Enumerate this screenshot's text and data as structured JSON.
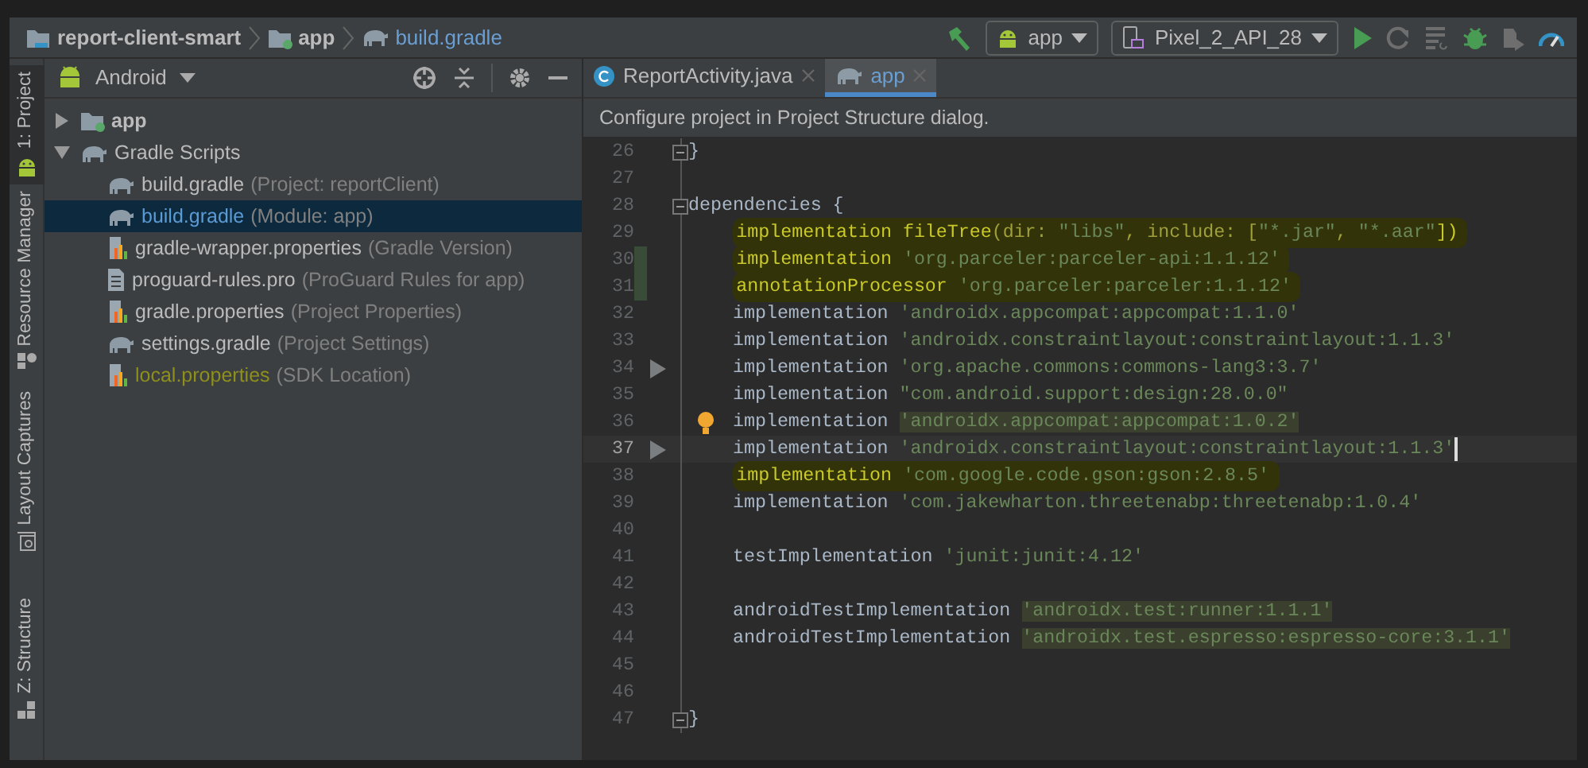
{
  "breadcrumbs": [
    {
      "label": "report-client-smart",
      "kind": "project",
      "current": false
    },
    {
      "label": "app",
      "kind": "module",
      "current": false
    },
    {
      "label": "build.gradle",
      "kind": "gradle",
      "current": true
    }
  ],
  "toolbar": {
    "run_configuration": "app",
    "device": "Pixel_2_API_28"
  },
  "tool_stripe": [
    {
      "label": "1: Project",
      "selected": true
    },
    {
      "label": "Resource Manager",
      "selected": false
    },
    {
      "label": "Layout Captures",
      "selected": false
    },
    {
      "label": "Z: Structure",
      "selected": false
    }
  ],
  "project_panel": {
    "view": "Android",
    "tree": [
      {
        "label": "app",
        "kind": "module",
        "expanded": false,
        "selected": false,
        "ignored": false
      },
      {
        "label": "Gradle Scripts",
        "kind": "gradle",
        "expanded": true,
        "selected": false,
        "ignored": false,
        "children": [
          {
            "label": "build.gradle",
            "detail": "(Project: reportClient)",
            "kind": "gradle",
            "selected": false,
            "ignored": false
          },
          {
            "label": "build.gradle",
            "detail": "(Module: app)",
            "kind": "gradle",
            "selected": true,
            "ignored": false
          },
          {
            "label": "gradle-wrapper.properties",
            "detail": "(Gradle Version)",
            "kind": "properties",
            "selected": false,
            "ignored": false
          },
          {
            "label": "proguard-rules.pro",
            "detail": "(ProGuard Rules for app)",
            "kind": "text",
            "selected": false,
            "ignored": false
          },
          {
            "label": "gradle.properties",
            "detail": "(Project Properties)",
            "kind": "properties",
            "selected": false,
            "ignored": false
          },
          {
            "label": "settings.gradle",
            "detail": "(Project Settings)",
            "kind": "gradle",
            "selected": false,
            "ignored": false
          },
          {
            "label": "local.properties",
            "detail": "(SDK Location)",
            "kind": "properties",
            "selected": false,
            "ignored": true
          }
        ]
      }
    ]
  },
  "editor": {
    "tabs": [
      {
        "label": "ReportActivity.java",
        "kind": "java",
        "selected": false
      },
      {
        "label": "app",
        "kind": "gradle",
        "selected": true
      }
    ],
    "notification": "Configure project in Project Structure dialog.",
    "lines": [
      {
        "number": "26",
        "kind": "fold",
        "segments": [
          {
            "text": "}",
            "kind": "code"
          }
        ]
      },
      {
        "number": "27",
        "kind": "plain"
      },
      {
        "number": "28",
        "kind": "fold",
        "segments": [
          {
            "text": "dependencies {",
            "kind": "code"
          }
        ]
      },
      {
        "number": "29",
        "kind": "plain",
        "marked": true,
        "segments": [
          {
            "text": "implementation fileTree",
            "kind": "code"
          },
          {
            "text": "(dir: ",
            "kind": "param"
          },
          {
            "text": "\"libs\"",
            "kind": "string"
          },
          {
            "text": ", include: [",
            "kind": "param"
          },
          {
            "text": "\"*.jar\"",
            "kind": "string"
          },
          {
            "text": ", ",
            "kind": "param"
          },
          {
            "text": "\"*.aar\"",
            "kind": "string"
          },
          {
            "text": "])",
            "kind": "code"
          }
        ]
      },
      {
        "number": "30",
        "kind": "changed",
        "marked": true,
        "segments": [
          {
            "text": "implementation ",
            "kind": "code"
          },
          {
            "text": "'org.parceler:parceler-api:1.1.12'",
            "kind": "string"
          }
        ]
      },
      {
        "number": "31",
        "kind": "changed",
        "marked": true,
        "segments": [
          {
            "text": "annotationProcessor ",
            "kind": "code"
          },
          {
            "text": "'org.parceler:parceler:1.1.12'",
            "kind": "string"
          }
        ]
      },
      {
        "number": "32",
        "kind": "plain",
        "marked": false,
        "segments": [
          {
            "text": "implementation ",
            "kind": "code"
          },
          {
            "text": "'androidx.appcompat:appcompat:1.1.0'",
            "kind": "string"
          }
        ]
      },
      {
        "number": "33",
        "kind": "plain",
        "marked": false,
        "segments": [
          {
            "text": "implementation ",
            "kind": "code"
          },
          {
            "text": "'androidx.constraintlayout:constraintlayout:1.1.3'",
            "kind": "string"
          }
        ]
      },
      {
        "number": "34",
        "kind": "run",
        "marked": false,
        "segments": [
          {
            "text": "implementation ",
            "kind": "code"
          },
          {
            "text": "'org.apache.commons:commons-lang3:3.7'",
            "kind": "string"
          }
        ]
      },
      {
        "number": "35",
        "kind": "plain",
        "marked": false,
        "segments": [
          {
            "text": "implementation ",
            "kind": "code"
          },
          {
            "text": "\"com.android.support:design:28.0.0\"",
            "kind": "string"
          }
        ]
      },
      {
        "number": "36",
        "kind": "bulb",
        "marked": false,
        "segments": [
          {
            "text": "implementation ",
            "kind": "code"
          },
          {
            "text": "'androidx.appcompat:appcompat:1.0.2'",
            "kind": "found"
          }
        ]
      },
      {
        "number": "37",
        "kind": "run",
        "marked": false,
        "current": true,
        "segments": [
          {
            "text": "implementation ",
            "kind": "code"
          },
          {
            "text": "'androidx.constraintlayout:constraintlayout:1.1.3'",
            "kind": "string"
          }
        ]
      },
      {
        "number": "38",
        "kind": "plain",
        "marked": true,
        "segments": [
          {
            "text": "implementation ",
            "kind": "code"
          },
          {
            "text": "'com.google.code.gson:gson:2.8.5'",
            "kind": "string"
          }
        ]
      },
      {
        "number": "39",
        "kind": "plain",
        "marked": false,
        "segments": [
          {
            "text": "implementation ",
            "kind": "code"
          },
          {
            "text": "'com.jakewharton.threetenabp:threetenabp:1.0.4'",
            "kind": "string"
          }
        ]
      },
      {
        "number": "40",
        "kind": "plain"
      },
      {
        "number": "41",
        "kind": "plain",
        "marked": false,
        "segments": [
          {
            "text": "testImplementation ",
            "kind": "code"
          },
          {
            "text": "'junit:junit:4.12'",
            "kind": "string"
          }
        ]
      },
      {
        "number": "42",
        "kind": "plain"
      },
      {
        "number": "43",
        "kind": "plain",
        "marked": false,
        "segments": [
          {
            "text": "androidTestImplementation ",
            "kind": "code"
          },
          {
            "text": "'androidx.test:runner:1.1.1'",
            "kind": "found"
          }
        ]
      },
      {
        "number": "44",
        "kind": "plain",
        "marked": false,
        "segments": [
          {
            "text": "androidTestImplementation ",
            "kind": "code"
          },
          {
            "text": "'androidx.test.espresso:espresso-core:3.1.1'",
            "kind": "found"
          }
        ]
      },
      {
        "number": "45",
        "kind": "plain"
      },
      {
        "number": "46",
        "kind": "plain"
      },
      {
        "number": "47",
        "kind": "fold",
        "segments": [
          {
            "text": "}",
            "kind": "code"
          }
        ]
      }
    ]
  }
}
